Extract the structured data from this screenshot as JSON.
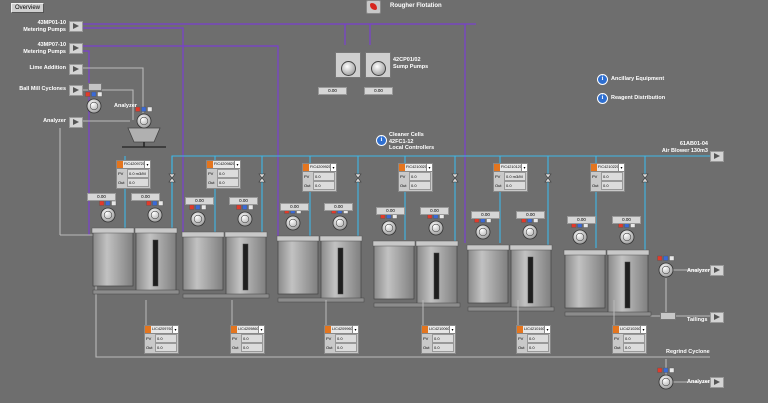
{
  "toolbar": {
    "overview_label": "Overview"
  },
  "title": {
    "text": "Rougher Flotation"
  },
  "left_sources": [
    {
      "line1": "43MP01-10",
      "line2": "Metering Pumps"
    },
    {
      "line1": "43MP07-10",
      "line2": "Metering Pumps"
    },
    {
      "line1": "Lime Addition",
      "line2": ""
    },
    {
      "line1": "Ball Mill Cyclones",
      "line2": ""
    },
    {
      "line1": "Analyzer",
      "line2": ""
    }
  ],
  "analyzer_label": "Analyzer",
  "sump_pumps": {
    "line1": "42CP01/02",
    "line2": "Sump Pumps",
    "values": [
      "0.00",
      "0.00"
    ]
  },
  "menu_links": {
    "ancillary": "Ancillary Equipment",
    "reagent": "Reagent Distribution"
  },
  "cleaner_cells": {
    "line1": "Cleaner Cells",
    "line2": "42FC1-12",
    "line3": "Local Controllers"
  },
  "air_blower": {
    "line1": "61AB01-04",
    "line2": "Air Blower 130m3"
  },
  "right_outputs": {
    "analyzer_1": "Analyzer",
    "tailings": "Tailings",
    "regrind": "Regrind Cyclone",
    "analyzer_2": "Analyzer"
  },
  "flow_controllers": [
    {
      "tag": "FIC4209720",
      "pv": "0.0 m3/M",
      "out": "0.0"
    },
    {
      "tag": "FIC4209820",
      "pv": "0.0",
      "out": "0.0"
    },
    {
      "tag": "FIC4209920",
      "pv": "0.0",
      "out": "0.0"
    },
    {
      "tag": "FIC4210020",
      "pv": "0.0",
      "out": "0.0"
    },
    {
      "tag": "FIC4210120",
      "pv": "0.0 m3/M",
      "out": "0.0"
    },
    {
      "tag": "FIC4210220",
      "pv": "0.0",
      "out": "0.0"
    }
  ],
  "level_controllers": [
    {
      "tag": "LIC4209760",
      "pv": "0.0",
      "out": "0.0"
    },
    {
      "tag": "LIC4209860",
      "pv": "0.0",
      "out": "0.0"
    },
    {
      "tag": "LIC4209960",
      "pv": "0.0",
      "out": "0.0"
    },
    {
      "tag": "LIC4210060",
      "pv": "0.0",
      "out": "0.0"
    },
    {
      "tag": "LIC4210160",
      "pv": "0.0",
      "out": "0.0"
    },
    {
      "tag": "LIC4210260",
      "pv": "0.0",
      "out": "0.0"
    }
  ],
  "faceplate_labels": {
    "pv": "PV",
    "out": "Out"
  },
  "cell_values": [
    "0.00",
    "0.00",
    "0.00",
    "0.00",
    "0.00",
    "0.00",
    "0.00",
    "0.00",
    "0.00",
    "0.00",
    "0.00",
    "0.00"
  ],
  "colors": {
    "background": "#6e6e6e",
    "purple_line": "#7a3fd0",
    "blue_line": "#3db8e8",
    "grey_line": "#b8b8b8",
    "tank": "#a6a6a6"
  }
}
